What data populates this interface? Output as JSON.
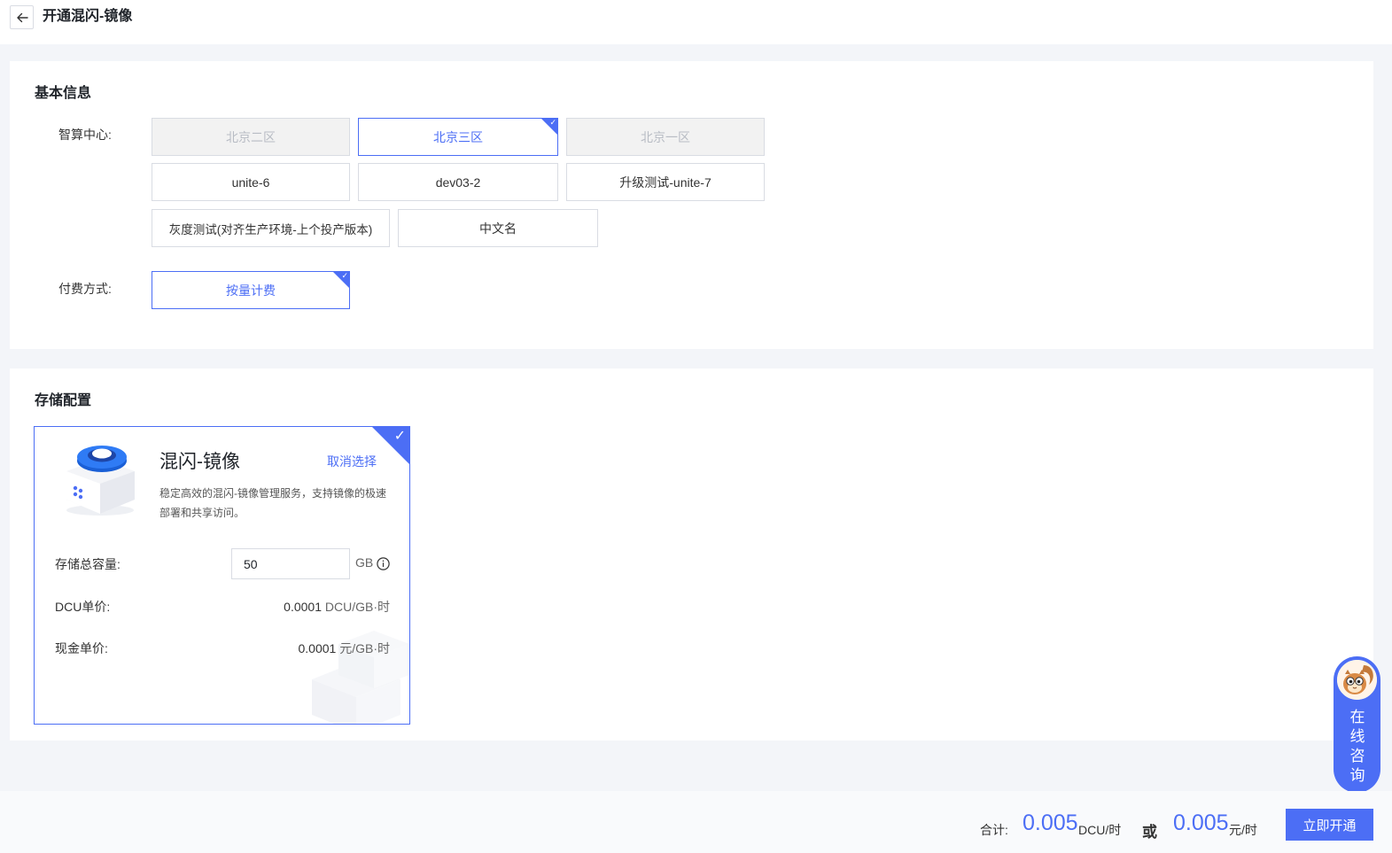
{
  "header": {
    "title": "开通混闪-镜像"
  },
  "basic_info": {
    "title": "基本信息",
    "center_label": "智算中心:",
    "centers": [
      {
        "label": "北京二区",
        "state": "disabled"
      },
      {
        "label": "北京三区",
        "state": "selected"
      },
      {
        "label": "北京一区",
        "state": "disabled"
      },
      {
        "label": "unite-6",
        "state": "normal"
      },
      {
        "label": "dev03-2",
        "state": "normal"
      },
      {
        "label": "升级测试-unite-7",
        "state": "normal"
      },
      {
        "label": "灰度测试(对齐生产环境-上个投产版本)",
        "state": "normal"
      },
      {
        "label": "中文名",
        "state": "normal"
      }
    ],
    "billing_label": "付费方式:",
    "billing_option": "按量计费"
  },
  "storage": {
    "title": "存储配置",
    "product_name": "混闪-镜像",
    "cancel_label": "取消选择",
    "description": "稳定高效的混闪-镜像管理服务，支持镜像的极速部署和共享访问。",
    "capacity_label": "存储总容量:",
    "capacity_value": "50",
    "capacity_unit": "GB",
    "dcu_price_label": "DCU单价:",
    "dcu_price_value": "0.0001",
    "dcu_price_unit": "DCU/GB·时",
    "cash_price_label": "现金单价:",
    "cash_price_value": "0.0001",
    "cash_price_unit": "元/GB·时"
  },
  "footer": {
    "total_label": "合计:",
    "dcu_total": "0.005",
    "dcu_unit": "DCU/时",
    "or_label": "或",
    "cash_total": "0.005",
    "cash_unit": "元/时",
    "submit_label": "立即开通"
  },
  "consult": {
    "label": "在线咨询"
  },
  "colors": {
    "accent": "#4c6ef5",
    "disabled_bg": "#f2f2f2",
    "page_bg": "#f3f5f9"
  }
}
